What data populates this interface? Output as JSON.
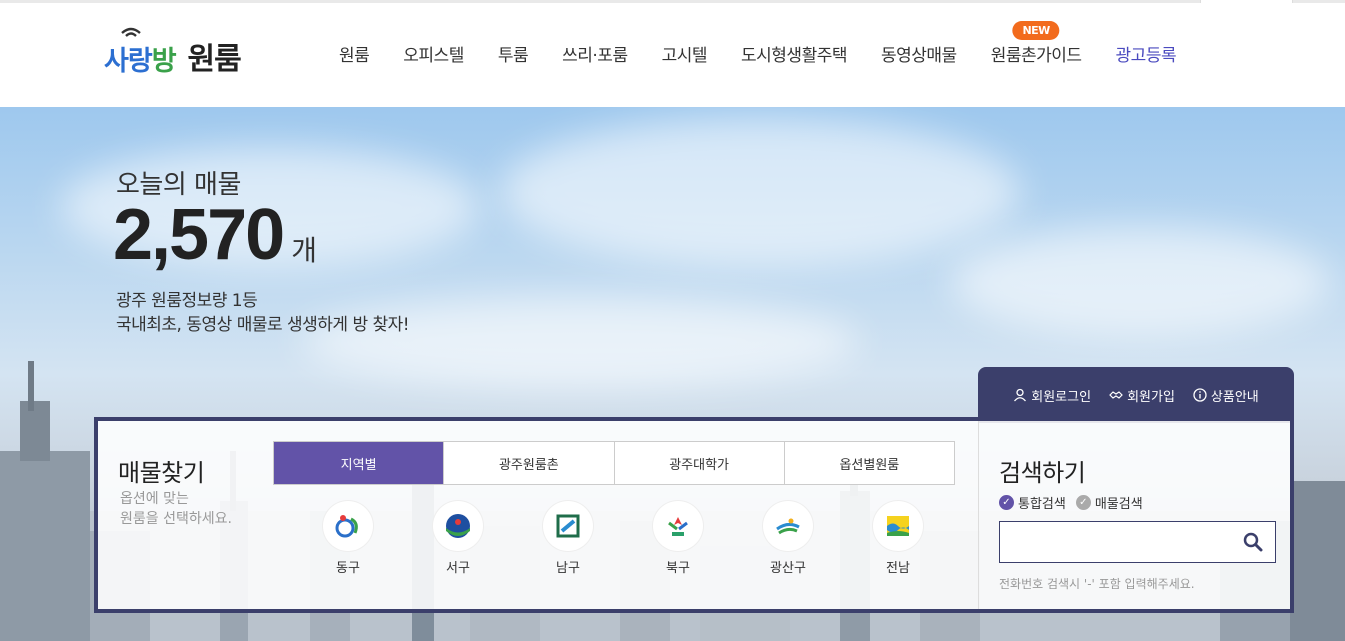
{
  "logo": {
    "part1_a": "사랑",
    "part1_b": "방",
    "part2": "원룸"
  },
  "nav": {
    "items": [
      "원룸",
      "오피스텔",
      "투룸",
      "쓰리·포룸",
      "고시텔",
      "도시형생활주택",
      "동영상매물",
      "원룸촌가이드"
    ],
    "new_badge": "NEW",
    "ad_label": "광고등록"
  },
  "hero": {
    "today_label": "오늘의 매물",
    "today_count": "2,570",
    "today_unit": "개",
    "tagline1": "광주 원룸정보량 1등",
    "tagline2": "국내최초, 동영상 매물로 생생하게 방 찾자!"
  },
  "member": {
    "login": "회원로그인",
    "join": "회원가입",
    "product": "상품안내"
  },
  "find": {
    "title": "매물찾기",
    "sub1": "옵션에 맞는",
    "sub2": "원룸을 선택하세요.",
    "tabs": [
      "지역별",
      "광주원룸촌",
      "광주대학가",
      "옵션별원룸"
    ],
    "regions": [
      "동구",
      "서구",
      "남구",
      "북구",
      "광산구",
      "전남"
    ]
  },
  "search": {
    "title": "검색하기",
    "opt_all": "통합검색",
    "opt_items": "매물검색",
    "placeholder": "",
    "hint": "전화번호 검색시 '-' 포함 입력해주세요."
  },
  "colors": {
    "accent": "#6253a8",
    "panel_border": "#3b3f6b",
    "new_badge": "#f26b1d",
    "ad_link": "#4a4abf"
  }
}
